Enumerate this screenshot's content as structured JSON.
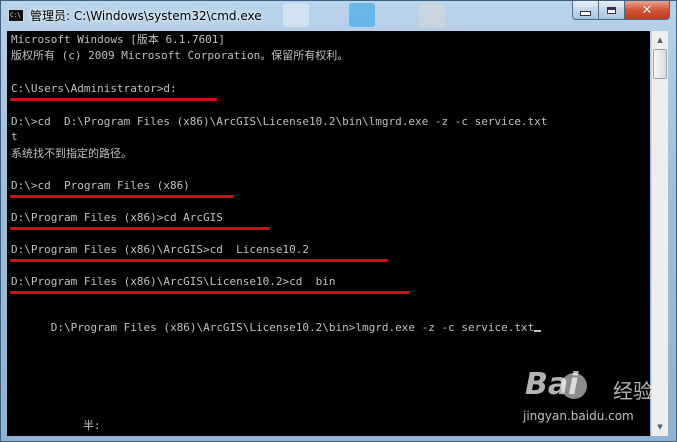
{
  "window": {
    "title": "管理员: C:\\Windows\\system32\\cmd.exe",
    "app_icon_label": "C:\\",
    "controls": {
      "minimize": "minimize",
      "maximize": "maximize",
      "close": "✕"
    }
  },
  "console": {
    "lines": [
      "Microsoft Windows [版本 6.1.7601]",
      "版权所有 (c) 2009 Microsoft Corporation。保留所有权利。",
      "C:\\Users\\Administrator>d:",
      "D:\\>cd  D:\\Program Files (x86)\\ArcGIS\\License10.2\\bin\\lmgrd.exe -z -c service.txt",
      "t",
      "系统找不到指定的路径。",
      "D:\\>cd  Program Files (x86)",
      "D:\\Program Files (x86)>cd ArcGIS",
      "D:\\Program Files (x86)\\ArcGIS>cd  License10.2",
      "D:\\Program Files (x86)\\ArcGIS\\License10.2>cd  bin",
      "D:\\Program Files (x86)\\ArcGIS\\License10.2\\bin>lmgrd.exe -z -c service.txt",
      "半:"
    ],
    "underline_color": "#d21212",
    "text_color": "#c0c0c0",
    "background_color": "#000000"
  },
  "watermark": {
    "brand": "Bai",
    "brand_suffix": "经验",
    "url": "jingyan.baidu.com"
  }
}
